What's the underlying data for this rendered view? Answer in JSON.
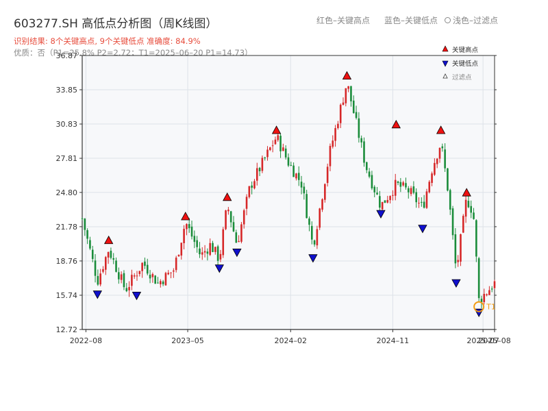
{
  "header": {
    "title": "603277.SH 高低点分析图（周K线图）",
    "legend_red": "红色–关键高点",
    "legend_blue": "蓝色–关键低点",
    "legend_light": "浅色–过滤点",
    "subtitle": "识别结果: 8个关键高点, 9个关键低点  准确度: 84.9%",
    "info": "优质：否（P1=25.8%  P2=2.72；T1=2025–06–20 P1=14.73）"
  },
  "colors": {
    "up": "#d62728",
    "down": "#1a8c3a",
    "high_marker": "#ee1111",
    "low_marker": "#1010cc",
    "t1_marker": "#f39c12",
    "plot_bg": "#f7f8fa",
    "grid": "#dde2e8"
  },
  "chart_data": {
    "type": "candlestick",
    "y_ticks": [
      "12.72",
      "15.74",
      "18.76",
      "21.78",
      "24.80",
      "27.81",
      "30.83",
      "33.85",
      "36.87"
    ],
    "y_range": [
      12.72,
      36.87
    ],
    "x_range": [
      "2022-07-22",
      "2025-08-01"
    ],
    "x_ticks": [
      {
        "date": "2022-08-01",
        "label": "2022–08"
      },
      {
        "date": "2023-05-01",
        "label": "2023–05"
      },
      {
        "date": "2024-02-01",
        "label": "2024–02"
      },
      {
        "date": "2024-11-01",
        "label": "2024–11"
      },
      {
        "date": "2025-07-01",
        "label": "2025–07"
      },
      {
        "date": "2025-08-01",
        "label": "2025–08"
      }
    ],
    "legend": [
      {
        "symbol": "triangle-up",
        "label": "关键高点"
      },
      {
        "symbol": "triangle-down",
        "label": "关键低点"
      },
      {
        "symbol": "triangle-up-hollow",
        "label": "过滤点"
      }
    ],
    "anchors": [
      [
        "2022-07-22",
        22.5
      ],
      [
        "2022-09-01",
        17.0
      ],
      [
        "2022-10-01",
        19.8
      ],
      [
        "2022-11-15",
        16.2
      ],
      [
        "2023-01-01",
        18.6
      ],
      [
        "2023-02-10",
        16.8
      ],
      [
        "2023-03-25",
        18.0
      ],
      [
        "2023-04-25",
        22.2
      ],
      [
        "2023-06-05",
        19.2
      ],
      [
        "2023-07-01",
        20.2
      ],
      [
        "2023-07-25",
        18.9
      ],
      [
        "2023-08-15",
        23.7
      ],
      [
        "2023-09-10",
        20.2
      ],
      [
        "2023-10-15",
        25.3
      ],
      [
        "2023-12-25",
        29.7
      ],
      [
        "2024-01-25",
        27.5
      ],
      [
        "2024-03-01",
        25.6
      ],
      [
        "2024-04-01",
        20.0
      ],
      [
        "2024-05-15",
        28.2
      ],
      [
        "2024-07-01",
        34.5
      ],
      [
        "2024-08-20",
        27.2
      ],
      [
        "2024-09-30",
        23.6
      ],
      [
        "2024-11-10",
        25.5
      ],
      [
        "2024-12-15",
        24.9
      ],
      [
        "2025-01-20",
        23.4
      ],
      [
        "2025-02-15",
        27.0
      ],
      [
        "2025-03-10",
        29.2
      ],
      [
        "2025-03-30",
        24.8
      ],
      [
        "2025-04-20",
        17.8
      ],
      [
        "2025-05-18",
        24.3
      ],
      [
        "2025-06-05",
        23.0
      ],
      [
        "2025-06-20",
        15.3
      ],
      [
        "2025-08-01",
        16.8
      ]
    ],
    "key_highs": [
      {
        "date": "2022-10-01",
        "price": 20.1
      },
      {
        "date": "2023-04-25",
        "price": 22.2
      },
      {
        "date": "2023-08-15",
        "price": 23.9
      },
      {
        "date": "2023-12-25",
        "price": 29.8
      },
      {
        "date": "2024-07-01",
        "price": 34.6
      },
      {
        "date": "2024-11-10",
        "price": 30.3
      },
      {
        "date": "2025-03-10",
        "price": 29.8
      },
      {
        "date": "2025-05-18",
        "price": 24.3
      }
    ],
    "key_lows": [
      {
        "date": "2022-09-01",
        "price": 16.3
      },
      {
        "date": "2022-12-15",
        "price": 16.2
      },
      {
        "date": "2023-07-25",
        "price": 18.6
      },
      {
        "date": "2023-09-10",
        "price": 20.0
      },
      {
        "date": "2024-04-01",
        "price": 19.5
      },
      {
        "date": "2024-09-30",
        "price": 23.4
      },
      {
        "date": "2025-01-20",
        "price": 22.1
      },
      {
        "date": "2025-04-20",
        "price": 17.3
      },
      {
        "date": "2025-06-20",
        "price": 14.7
      }
    ],
    "t1": {
      "date": "2025-06-20",
      "price": 14.73,
      "label": "T1"
    }
  }
}
